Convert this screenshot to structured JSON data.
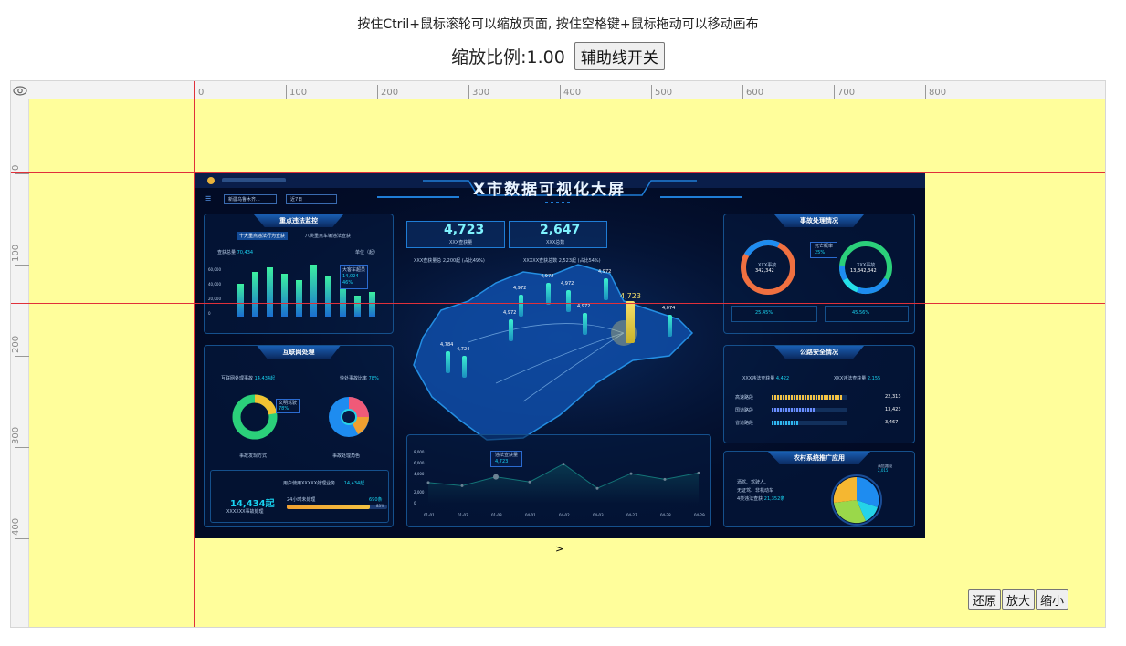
{
  "instructions": "按住Ctril+鼠标滚轮可以缩放页面, 按住空格键+鼠标拖动可以移动画布",
  "zoom": {
    "label": "缩放比例:1.00",
    "guide_button": "辅助线开关"
  },
  "ruler": {
    "top_labels": [
      "0",
      "100",
      "200",
      "300",
      "400",
      "500",
      "600",
      "700",
      "800"
    ],
    "left_labels": [
      "0",
      "100",
      "200",
      "300",
      "400"
    ]
  },
  "screen": {
    "title": "X市数据可视化大屏",
    "dropdowns": [
      "新疆乌鲁木齐...",
      "近7日"
    ],
    "left1": {
      "title": "重点违法监控",
      "tabs": [
        "十大重点违法行为查获",
        "八类重点车辆违法查获"
      ],
      "total_label": "查获总量",
      "total": "70,434",
      "unit": "单位（起）",
      "y_ticks": [
        "60,000",
        "40,000",
        "20,000",
        "0"
      ],
      "tooltip": [
        "大客车超员",
        "14,024",
        "46%"
      ],
      "bars": [
        40,
        55,
        60,
        52,
        44,
        63,
        50,
        41,
        26,
        30
      ]
    },
    "left2": {
      "title": "互联网处理",
      "stat1_label": "互联网处理事故",
      "stat1": "14,434起",
      "stat2_label": "快处事故比率",
      "stat2": "78%",
      "donut_tip": [
        "文明驾驶",
        "78%"
      ],
      "donut1_caption": "事故发现方式",
      "donut2_caption": "事故处理角色",
      "stat3": "14,434起",
      "stat3_label": "XXXXXX事故处理",
      "stat4_label": "用户使用XXXXX处理业务",
      "stat4": "14,434起",
      "progress_label": "24小时未处理",
      "progress_value": "690条",
      "progress": 0.83,
      "progress_pct": "83%"
    },
    "center": {
      "kpi1_value": "4,723",
      "kpi1_label": "XXX查获量",
      "kpi2_value": "2,647",
      "kpi2_label": "XXX总数",
      "sub1": "XXX查获量总 2,200起 (占比49%)",
      "sub2": "XXXXX查获总数 2,523起 (占比54%)",
      "map_values": [
        "4,723",
        "4,972",
        "4,972",
        "4,972",
        "4,972",
        "4,972",
        "4,972",
        "4,784",
        "4,724",
        "4,074"
      ],
      "line_tip": [
        "违法查获量",
        "4,723"
      ],
      "line_y": [
        "8,000",
        "6,000",
        "4,000",
        "2,000",
        "0"
      ],
      "line_x": [
        "01-01",
        "01-02",
        "01-03",
        "04-01",
        "04-02",
        "04-03",
        "04-27",
        "04-28",
        "04-29"
      ],
      "line_values": [
        3300,
        2800,
        4200,
        3400,
        6200,
        2400,
        4700,
        3800,
        4800
      ]
    },
    "right1": {
      "title": "事故处理情况",
      "d1_label": "XXX事故",
      "d1_value": "342,342",
      "tip_label": "死亡概率",
      "tip_value": "25%",
      "d2_label": "XXX事故",
      "d2_value": "13,342,342",
      "pct1": "25.45%",
      "pct2": "45.56%"
    },
    "right2": {
      "title": "公路安全情况",
      "s1_label": "XXX违法查获量",
      "s1": "4,422",
      "s2_label": "XXX违法查获量",
      "s2": "2,155",
      "rows": [
        {
          "name": "高速路段",
          "value": "22,313",
          "pct": 0.95
        },
        {
          "name": "国道路段",
          "value": "13,423",
          "pct": 0.6
        },
        {
          "name": "省道路段",
          "value": "3,467",
          "pct": 0.35
        }
      ]
    },
    "right3": {
      "title": "农村系统推广应用",
      "lines": [
        "酒驾、驾驶人、",
        "无证驾、非机动车",
        "4类违法查获"
      ],
      "count": "21,352条",
      "pie_tip": [
        "高危路段",
        "2,015"
      ]
    }
  },
  "controls": [
    "还原",
    "放大",
    "缩小"
  ],
  "caret": ">"
}
